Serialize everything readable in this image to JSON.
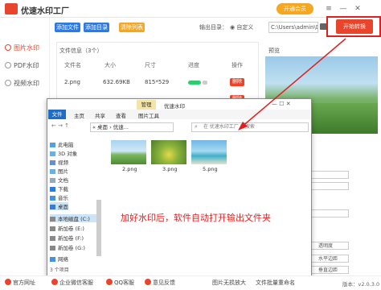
{
  "app": {
    "title": "优速水印工厂",
    "vip_label": "开通会员"
  },
  "window_controls": [
    "≡",
    "—",
    "✕"
  ],
  "sidebar": {
    "items": [
      {
        "label": "图片水印",
        "active": true
      },
      {
        "label": "PDF水印",
        "active": false
      },
      {
        "label": "视频水印",
        "active": false
      }
    ]
  },
  "toolbar": {
    "add_file": "添加文件",
    "add_dir": "添加目录",
    "clear_list": "清除列表",
    "output_label": "输出目录：",
    "radio_custom": "◉ 自定义",
    "output_path": "C:\\Users\\admin\\Deskto",
    "start_label": "开始转换"
  },
  "file_list": {
    "info": "文件信息（3个）",
    "headers": [
      "文件名",
      "大小",
      "尺寸",
      "进度",
      "操作"
    ],
    "rows": [
      {
        "name": "2.png",
        "size": "632.69KB",
        "dims": "815*529",
        "action": "删除"
      },
      {
        "name": "3.png",
        "size": "",
        "dims": "",
        "action": "删除"
      }
    ]
  },
  "preview": {
    "title": "预览",
    "labels": [
      "透明度",
      "水平边距",
      "垂直边距"
    ]
  },
  "explorer": {
    "title": "优速水印",
    "manage_tab": "管理",
    "tabs": [
      "文件",
      "主页",
      "共享",
      "查看",
      "图片工具"
    ],
    "address": "« 桌面 › 优速...",
    "search_placeholder": "在 优速水印工厂 中搜索",
    "tree": [
      "此电脑",
      "3D 对象",
      "视频",
      "图片",
      "文档",
      "下载",
      "音乐",
      "桌面",
      "本地磁盘 (C:)",
      "新加卷 (E:)",
      "新加卷 (F:)",
      "新加卷 (G:)",
      "网络"
    ],
    "files": [
      "2.png",
      "3.png",
      "5.png"
    ],
    "status": "3 个项目"
  },
  "annotation": "加好水印后，软件自动打开输出文件夹",
  "bottom": {
    "items": [
      "官方网址",
      "企业微信客服",
      "QQ客服",
      "意见反馈",
      "图片无损放大",
      "文件批量重命名"
    ],
    "version": "版本：v2.0.3.0"
  },
  "colors": {
    "accent": "#e8452c",
    "add_btn": "#2c7be5",
    "annotation": "#e02020",
    "progress": "#2ecc71"
  }
}
